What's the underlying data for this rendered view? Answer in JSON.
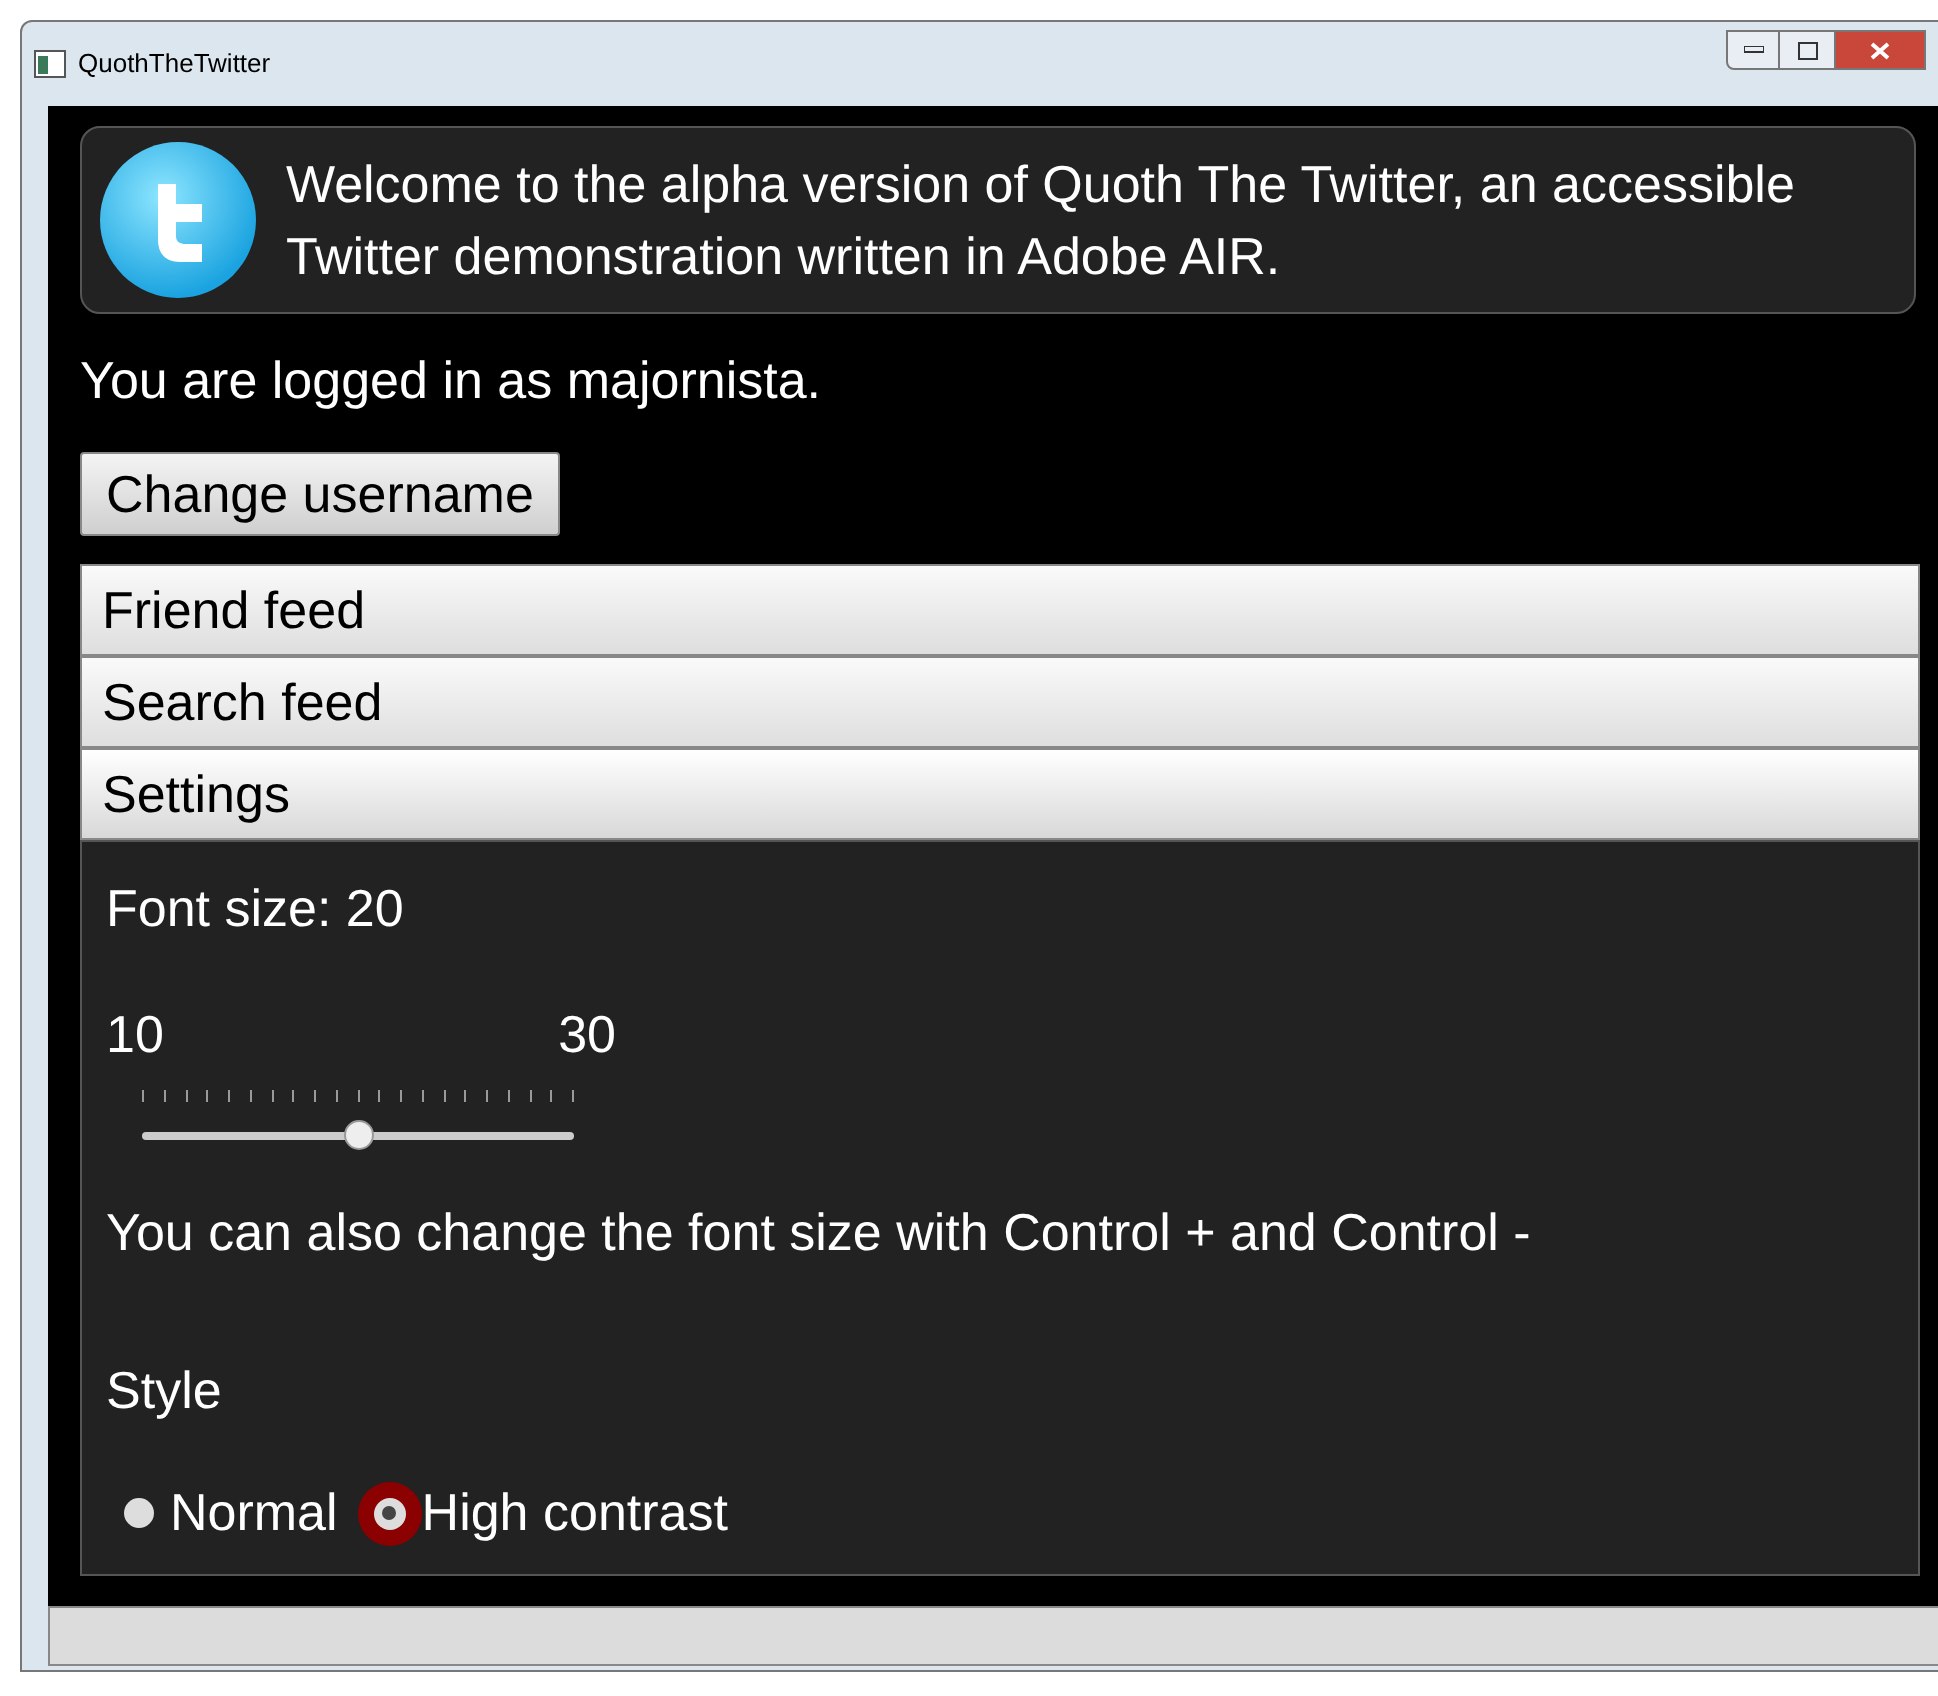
{
  "window": {
    "title": "QuothTheTwitter"
  },
  "welcome": "Welcome to the alpha version of Quoth The Twitter, an accessible Twitter demonstration written in Adobe AIR.",
  "login_status": "You are logged in as majornista.",
  "change_button": "Change username",
  "sections": [
    {
      "label": "Friend feed",
      "expanded": false
    },
    {
      "label": "Search feed",
      "expanded": false
    },
    {
      "label": "Settings",
      "expanded": true
    }
  ],
  "settings": {
    "font_size_label": "Font size: 20",
    "slider": {
      "min_label": "10",
      "max_label": "30",
      "level": 0.5
    },
    "hint": "You can also change the font size with Control + and Control -",
    "style_label": "Style",
    "styles": [
      {
        "label": "Normal",
        "selected": false
      },
      {
        "label": "High contrast",
        "selected": true
      }
    ]
  }
}
